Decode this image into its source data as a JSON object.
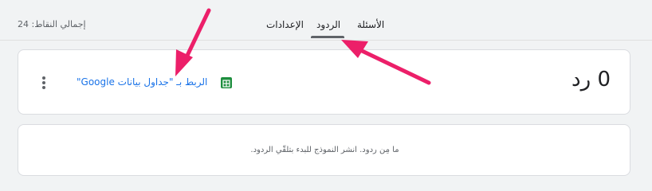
{
  "header": {
    "total_points": "إجمالي النقاط: 24",
    "tabs": [
      {
        "label": "الأسئلة"
      },
      {
        "label": "الردود"
      },
      {
        "label": "الإعدادات"
      }
    ]
  },
  "responses": {
    "count_label": "0 رد",
    "link_label": "الربط بـ \"جداول بيانات Google\"",
    "empty_message": "ما مِن ردود. انشر النموذج للبدء بتلقّي الردود."
  },
  "colors": {
    "accent_arrow": "#ec1f69",
    "link": "#1a73e8",
    "sheets_green": "#1e8e3e"
  }
}
